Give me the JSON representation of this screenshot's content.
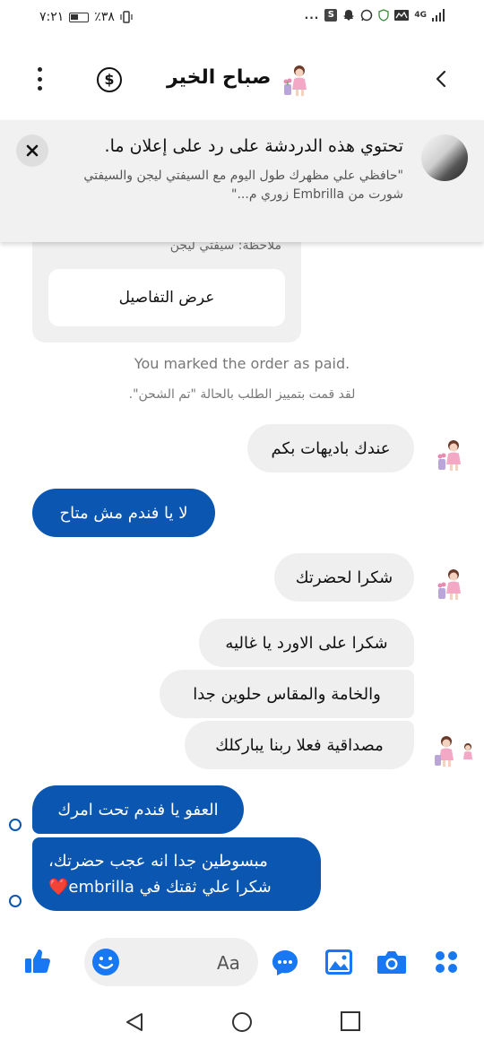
{
  "status_bar": {
    "time": "٧:٢١",
    "battery": "٪٣٨",
    "network": "4G",
    "dots": "..."
  },
  "header": {
    "title": "صباح الخير",
    "icons": [
      "menu-dots-icon",
      "dollar-icon",
      "avatar",
      "back-chevron-icon"
    ]
  },
  "banner": {
    "title": "تحتوي هذه الدردشة على رد على إعلان ما.",
    "text": "\"حافظي علي مظهرك طول اليوم مع السيفتي ليجن والسيفتي شورت من Embrilla زوري م...\""
  },
  "order_card": {
    "note": "ملاحظة: سيفتي ليجن",
    "details_button": "عرض التفاصيل"
  },
  "system_messages": {
    "en": "You marked the order as paid.",
    "ar": "لقد قمت بتمييز الطلب بالحالة \"تم الشحن\"."
  },
  "messages": [
    {
      "dir": "in",
      "text": "عندك باديهات بكم"
    },
    {
      "dir": "out",
      "text": "لا يا فندم مش متاح"
    },
    {
      "dir": "in",
      "text": "شكرا لحضرتك"
    },
    {
      "dir": "in",
      "text": "شكرا على الاورد يا غاليه"
    },
    {
      "dir": "in",
      "text": "والخامة والمقاس حلوين جدا"
    },
    {
      "dir": "in",
      "text": "مصداقية فعلا ربنا يباركلك"
    },
    {
      "dir": "out",
      "text": "العفو يا فندم تحت امرك"
    },
    {
      "dir": "out",
      "line1": "مبسوطين جدا انه عجب حضرتك،",
      "line2": "شكرا علي ثقتك في embrilla❤️"
    }
  ],
  "composer": {
    "placeholder": "Aa",
    "icons": [
      "like-icon",
      "emoji-icon",
      "chat-icon",
      "gallery-icon",
      "camera-icon",
      "apps-icon"
    ]
  },
  "colors": {
    "accent": "#1877f2",
    "outgoing_bubble": "#0a56b0",
    "incoming_bubble": "#efefef",
    "banner_bg": "#f1f1f1"
  }
}
